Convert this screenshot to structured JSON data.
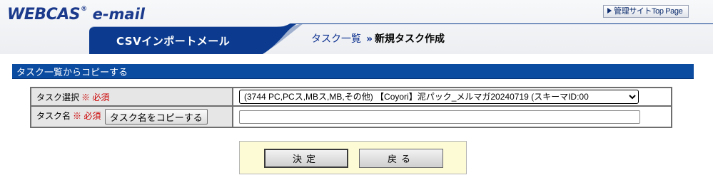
{
  "header": {
    "logo": "WEBCAS",
    "logo_reg": "®",
    "logo_sub": "e-mail",
    "admin_link": "管理サイトTop Page",
    "colors": {
      "header_blue": "#1b3a8c",
      "tab_blue": "#0b3a8e",
      "section_bar": "#0b4ba0"
    }
  },
  "tab": {
    "title": "CSVインポートメール"
  },
  "breadcrumb": {
    "link": "タスク一覧",
    "separator": "»",
    "current": "新規タスク作成"
  },
  "section": {
    "title": "タスク一覧からコピーする"
  },
  "form": {
    "task_select": {
      "label": "タスク選択",
      "required": "※ 必須",
      "selected": "(3744 PC,PCス,MBス,MB,その他) 【Coyori】泥パック_メルマガ20240719 (スキーマID:00"
    },
    "task_name": {
      "label": "タスク名",
      "required": "※ 必須",
      "copy_button": "タスク名をコピーする",
      "value": ""
    }
  },
  "actions": {
    "decide": "決定",
    "back": "戻る"
  }
}
